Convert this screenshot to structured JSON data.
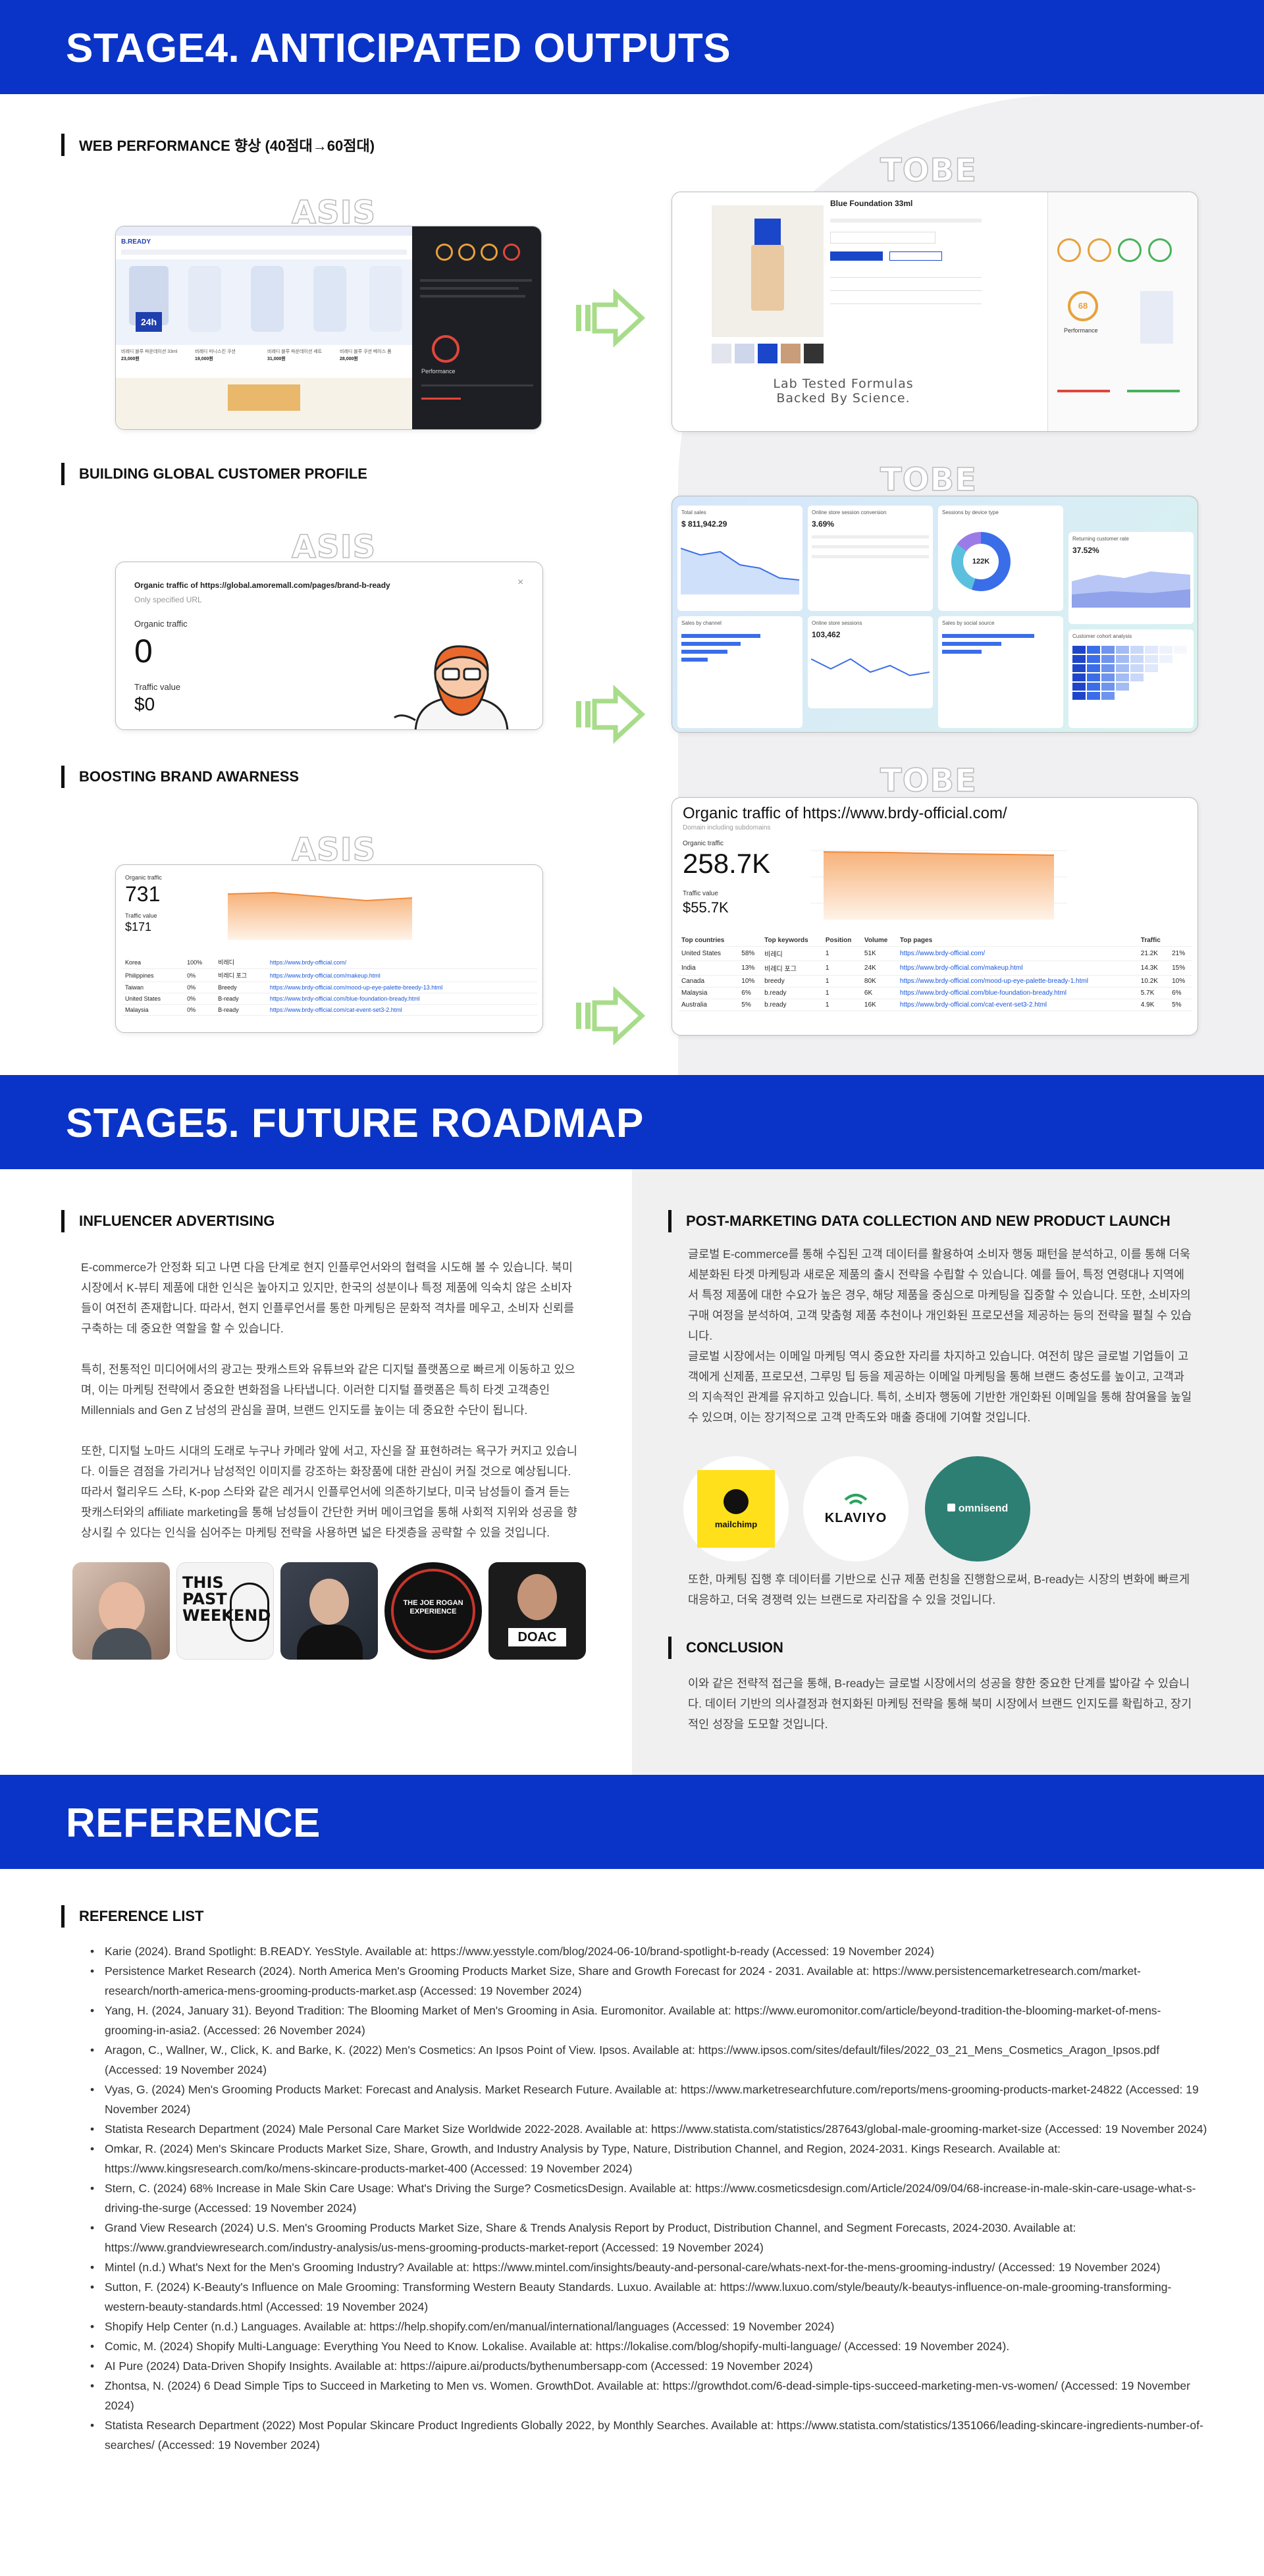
{
  "stage4": {
    "title": "STAGE4. ANTICIPATED OUTPUTS",
    "asis": "ASIS",
    "tobe": "TOBE",
    "sections": [
      {
        "title": "WEB PERFORMANCE 향상 (40점대→60점대)"
      },
      {
        "title": "BUILDING GLOBAL CUSTOMER PROFILE"
      },
      {
        "title": "BOOSTING BRAND AWARNESS"
      }
    ],
    "perf_asis": {
      "brand": "B.READY",
      "badge": "24h",
      "performance_label": "Performance",
      "products": [
        {
          "name": "비레디 블루 파운데이션 33ml",
          "price": "23,000원"
        },
        {
          "name": "비레디 미니스킨 쿠션",
          "price": "19,000원"
        },
        {
          "name": "비레디 블루 파운데이션 세트",
          "price": "31,000원"
        },
        {
          "name": "비레디 블루 쿠션 베이스 폼",
          "price": "28,000원"
        }
      ]
    },
    "perf_tobe": {
      "product_title": "Blue Foundation 33ml",
      "tagline": "Lab Tested Formulas Backed By Science.",
      "score": "68",
      "performance_label": "Performance"
    },
    "profile_asis": {
      "title": "Organic traffic of https://global.amoremall.com/pages/brand-b-ready",
      "subtitle": "Only specified URL",
      "organic_label": "Organic traffic",
      "organic_value": "0",
      "traffic_label": "Traffic value",
      "traffic_value": "$0"
    },
    "profile_tobe": {
      "total_sales_label": "Total sales",
      "total_sales": "$ 811,942.29",
      "conversion_label": "Online store session conversion",
      "conversion": "3.69%",
      "device_label": "Sessions by device type",
      "device_center": "122K",
      "returning_label": "Returning customer rate",
      "returning": "37.52%",
      "sessions_label": "Online store sessions",
      "sessions": "103,462",
      "sales_channel_label": "Sales by channel",
      "social_label": "Sales by social source",
      "cohort_label": "Customer cohort analysis"
    },
    "brand_asis": {
      "organic_label": "Organic traffic",
      "organic": "731",
      "traffic_label": "Traffic value",
      "traffic": "$171",
      "rows": [
        {
          "country": "Korea",
          "share": "100%",
          "kw": "비레디",
          "url": "https://www.brdy-official.com/"
        },
        {
          "country": "Philippines",
          "share": "0%",
          "kw": "비레디 포그",
          "url": "https://www.brdy-official.com/makeup.html"
        },
        {
          "country": "Taiwan",
          "share": "0%",
          "kw": "Breedy",
          "url": "https://www.brdy-official.com/mood-up-eye-palette-breedy-13.html"
        },
        {
          "country": "United States",
          "share": "0%",
          "kw": "B-ready",
          "url": "https://www.brdy-official.com/blue-foundation-bready.html"
        },
        {
          "country": "Malaysia",
          "share": "0%",
          "kw": "B-ready",
          "url": "https://www.brdy-official.com/cat-event-set3-2.html"
        }
      ]
    },
    "brand_tobe": {
      "title": "Organic traffic of https://www.brdy-official.com/",
      "subtitle": "Domain including subdomains",
      "organic_label": "Organic traffic",
      "organic": "258.7K",
      "traffic_label": "Traffic value",
      "traffic": "$55.7K",
      "headers": [
        "Top countries",
        "Top keywords",
        "Position",
        "Volume",
        "Top pages",
        "Traffic"
      ],
      "rows": [
        {
          "country": "United States",
          "share": "58%",
          "kw": "비레디",
          "pos": "1",
          "vol": "51K",
          "url": "https://www.brdy-official.com/",
          "traffic": "21.2K",
          "pct": "21%"
        },
        {
          "country": "India",
          "share": "13%",
          "kw": "비레디 포그",
          "pos": "1",
          "vol": "24K",
          "url": "https://www.brdy-official.com/makeup.html",
          "traffic": "14.3K",
          "pct": "15%"
        },
        {
          "country": "Canada",
          "share": "10%",
          "kw": "breedy",
          "pos": "1",
          "vol": "80K",
          "url": "https://www.brdy-official.com/mood-up-eye-palette-bready-1.html",
          "traffic": "10.2K",
          "pct": "10%"
        },
        {
          "country": "Malaysia",
          "share": "6%",
          "kw": "b.ready",
          "pos": "1",
          "vol": "6K",
          "url": "https://www.brdy-official.com/blue-foundation-bready.html",
          "traffic": "5.7K",
          "pct": "6%"
        },
        {
          "country": "Australia",
          "share": "5%",
          "kw": "b.ready",
          "pos": "1",
          "vol": "16K",
          "url": "https://www.brdy-official.com/cat-event-set3-2.html",
          "traffic": "4.9K",
          "pct": "5%"
        }
      ]
    }
  },
  "stage5": {
    "title": "STAGE5. FUTURE ROADMAP",
    "influencer": {
      "title": "INFLUENCER ADVERTISING",
      "p1": "E-commerce가 안정화 되고 나면 다음 단계로 현지 인플루언서와의 협력을 시도해 볼 수 있습니다. 북미 시장에서 K-뷰티 제품에 대한 인식은 높아지고 있지만, 한국의 성분이나 특정 제품에 익숙치 않은 소비자들이 여전히 존재합니다. 따라서, 현지 인플루언서를 통한 마케팅은 문화적 격차를 메우고, 소비자 신뢰를 구축하는 데 중요한 역할을 할 수 있습니다.",
      "p2": "특히, 전통적인 미디어에서의 광고는 팟캐스트와 유튜브와 같은 디지털 플랫폼으로 빠르게 이동하고 있으며, 이는 마케팅 전략에서 중요한 변화점을 나타냅니다. 이러한 디지털 플랫폼은 특히 타겟 고객층인 Millennials and Gen Z 남성의 관심을 끌며, 브랜드 인지도를 높이는 데 중요한 수단이 됩니다.",
      "p3": "또한, 디지털 노마드 시대의 도래로 누구나 카메라 앞에 서고, 자신을 잘 표현하려는 욕구가 커지고 있습니다. 이들은 겸점을 가리거나 남성적인 이미지를 강조하는 화장품에 대한 관심이 커질 것으로 예상됩니다. 따라서 헐리우드 스타, K-pop 스타와 같은 레거시 인플루언서에 의존하기보다, 미국 남성들이 즐겨 듣는 팟캐스터와의 affiliate marketing을 통해 남성들이 간단한 커버 메이크업을 통해 사회적 지위와 성공을 향상시킬 수 있다는 인식을 심어주는 마케팅 전략을 사용하면 넓은 타겟층을 공략할 수 있을 것입니다.",
      "avatars": [
        {
          "name": "person-1"
        },
        {
          "name": "this-past-weekend",
          "text": "THIS PAST WEEKEND"
        },
        {
          "name": "person-3"
        },
        {
          "name": "the-joe-rogan-experience",
          "text": "THE JOE ROGAN EXPERIENCE"
        },
        {
          "name": "doac",
          "text": "DOAC"
        }
      ]
    },
    "post": {
      "title": "POST-MARKETING DATA COLLECTION AND NEW PRODUCT LAUNCH",
      "p1": "글로벌 E-commerce를 통해 수집된 고객 데이터를 활용하여 소비자 행동 패턴을 분석하고, 이를 통해 더욱 세분화된 타겟 마케팅과 새로운 제품의 출시 전략을 수립할 수 있습니다. 예를 들어, 특정 연령대나 지역에서 특정 제품에 대한 수요가 높은 경우, 해당 제품을 중심으로 마케팅을 집중할 수 있습니다. 또한, 소비자의 구매 여정을 분석하여, 고객 맞춤형 제품 추천이나 개인화된 프로모션을 제공하는 등의 전략을 펼칠 수 있습니다.",
      "p2": "글로벌 시장에서는 이메일 마케팅 역시 중요한 자리를 차지하고 있습니다. 여전히 많은 글로벌 기업들이 고객에게 신제품, 프로모션, 그루밍 팁 등을 제공하는 이메일 마케팅을 통해 브랜드 충성도를 높이고, 고객과의 지속적인 관계를 유지하고 있습니다. 특히, 소비자 행동에 기반한 개인화된 이메일을 통해 참여율을 높일 수 있으며, 이는 장기적으로 고객 만족도와 매출 증대에 기여할 것입니다.",
      "p3": "또한, 마케팅 집행 후 데이터를 기반으로 신규 제품 런칭을 진행함으로써, B-ready는 시장의 변화에 빠르게 대응하고, 더욱 경쟁력 있는 브랜드로 자리잡을 수 있을 것입니다.",
      "logos": [
        {
          "name": "mailchimp",
          "text": "mailchimp"
        },
        {
          "name": "klaviyo",
          "text": "KLAVIYO"
        },
        {
          "name": "omnisend",
          "text": "omnisend"
        }
      ]
    },
    "conclusion": {
      "title": "CONCLUSION",
      "p1": "이와 같은 전략적 접근을 통해, B-ready는 글로벌 시장에서의 성공을 향한 중요한 단계를 밟아갈 수 있습니다. 데이터 기반의 의사결정과 현지화된 마케팅 전략을 통해 북미 시장에서 브랜드 인지도를 확립하고, 장기적인 성장을 도모할 것입니다."
    }
  },
  "reference": {
    "title": "REFERENCE",
    "list_title": "REFERENCE LIST",
    "items": [
      "Karie (2024). Brand Spotlight: B.READY. YesStyle. Available at: https://www.yesstyle.com/blog/2024-06-10/brand-spotlight-b-ready (Accessed: 19 November 2024)",
      "Persistence Market Research (2024). North America Men's Grooming Products Market Size, Share and Growth Forecast for 2024 - 2031. Available at: https://www.persistencemarketresearch.com/market-research/north-america-mens-grooming-products-market.asp (Accessed: 19 November 2024)",
      "Yang, H. (2024, January 31). Beyond Tradition: The Blooming Market of Men's Grooming in Asia. Euromonitor. Available at: https://www.euromonitor.com/article/beyond-tradition-the-blooming-market-of-mens-grooming-in-asia2. (Accessed: 26 November 2024)",
      "Aragon, C., Wallner, W., Click, K. and Barke, K. (2022) Men's Cosmetics: An Ipsos Point of View. Ipsos. Available at: https://www.ipsos.com/sites/default/files/2022_03_21_Mens_Cosmetics_Aragon_Ipsos.pdf (Accessed: 19 November 2024)",
      "Vyas, G. (2024) Men's Grooming Products Market: Forecast and Analysis. Market Research Future. Available at: https://www.marketresearchfuture.com/reports/mens-grooming-products-market-24822 (Accessed: 19 November 2024)",
      "Statista Research Department (2024) Male Personal Care Market Size Worldwide 2022-2028. Available at: https://www.statista.com/statistics/287643/global-male-grooming-market-size (Accessed: 19 November 2024)",
      "Omkar, R. (2024) Men's Skincare Products Market Size, Share, Growth, and Industry Analysis by Type, Nature, Distribution Channel, and Region, 2024-2031. Kings Research. Available at: https://www.kingsresearch.com/ko/mens-skincare-products-market-400 (Accessed: 19 November 2024)",
      "Stern, C. (2024) 68% Increase in Male Skin Care Usage: What's Driving the Surge? CosmeticsDesign. Available at: https://www.cosmeticsdesign.com/Article/2024/09/04/68-increase-in-male-skin-care-usage-what-s-driving-the-surge (Accessed: 19 November 2024)",
      "Grand View Research (2024) U.S. Men's Grooming Products Market Size, Share & Trends Analysis Report by Product, Distribution Channel, and Segment Forecasts, 2024-2030. Available at: https://www.grandviewresearch.com/industry-analysis/us-mens-grooming-products-market-report (Accessed: 19 November 2024)",
      "Mintel (n.d.) What's Next for the Men's Grooming Industry? Available at: https://www.mintel.com/insights/beauty-and-personal-care/whats-next-for-the-mens-grooming-industry/ (Accessed: 19 November 2024)",
      "Sutton, F. (2024) K-Beauty's Influence on Male Grooming: Transforming Western Beauty Standards. Luxuo. Available at: https://www.luxuo.com/style/beauty/k-beautys-influence-on-male-grooming-transforming-western-beauty-standards.html (Accessed: 19 November 2024)",
      "Shopify Help Center (n.d.) Languages. Available at: https://help.shopify.com/en/manual/international/languages (Accessed: 19 November 2024)",
      "Comic, M. (2024) Shopify Multi-Language: Everything You Need to Know. Lokalise. Available at: https://lokalise.com/blog/shopify-multi-language/ (Accessed: 19 November 2024).",
      "AI Pure (2024) Data-Driven Shopify Insights. Available at: https://aipure.ai/products/bythenumbersapp-com (Accessed: 19 November 2024)",
      "Zhontsa, N. (2024) 6 Dead Simple Tips to Succeed in Marketing to Men vs. Women. GrowthDot. Available at: https://growthdot.com/6-dead-simple-tips-succeed-marketing-men-vs-women/ (Accessed: 19 November 2024)",
      "Statista Research Department (2022) Most Popular Skincare Product Ingredients Globally 2022, by Monthly Searches. Available at: https://www.statista.com/statistics/1351066/leading-skincare-ingredients-number-of-searches/ (Accessed: 19 November 2024)"
    ]
  }
}
